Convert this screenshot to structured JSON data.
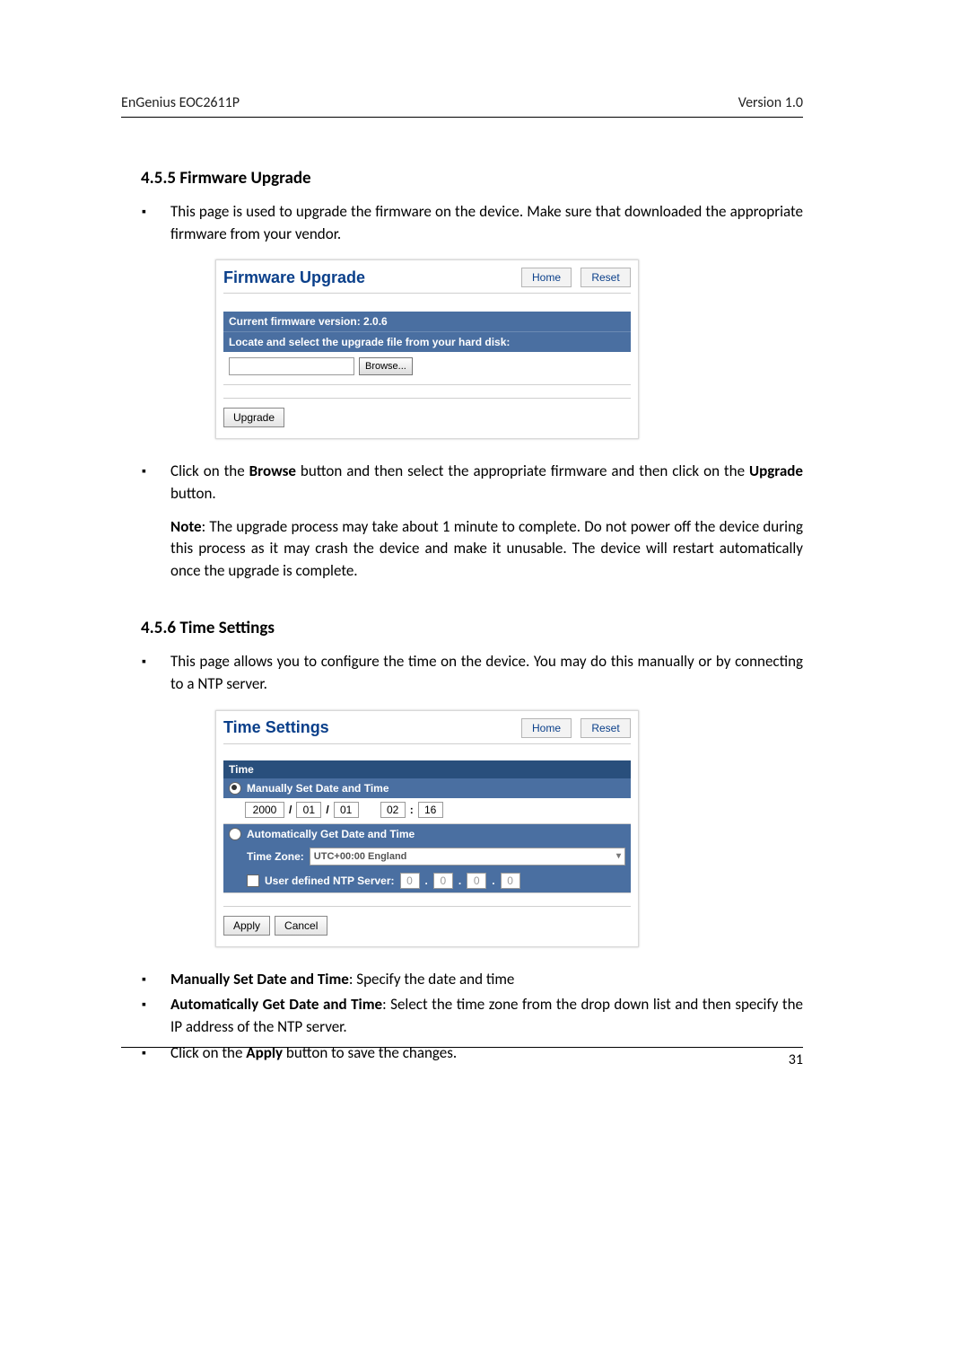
{
  "header": {
    "left": "EnGenius   EOC2611P",
    "right": "Version 1.0"
  },
  "page_num": "31",
  "s455": {
    "heading": "4.5.5   Firmware Upgrade",
    "intro": "This page is used to upgrade the firmware on the device. Make sure that downloaded the appropriate firmware from your vendor.",
    "shot": {
      "title": "Firmware Upgrade",
      "home": "Home",
      "reset": "Reset",
      "cur": "Current firmware version: 2.0.6",
      "locate": "Locate and select the upgrade file from your hard disk:",
      "browse": "Browse...",
      "upgrade": "Upgrade",
      "file_value": ""
    },
    "step_browse_pre": "Click on the ",
    "step_browse_b1": "Browse",
    "step_browse_mid": " button and then select the appropriate firmware and then click on the ",
    "step_browse_b2": "Upgrade",
    "step_browse_post": " button.",
    "note_b": "Note",
    "note": ": The upgrade process may take about 1 minute to complete. Do not power off the device during this process as it may crash the device and make it unusable. The device will restart automatically once the upgrade is complete."
  },
  "s456": {
    "heading": "4.5.6   Time Settings",
    "intro": "This page allows you to configure the time on the device. You may do this manually or by connecting to a NTP server.",
    "shot": {
      "title": "Time Settings",
      "home": "Home",
      "reset": "Reset",
      "bar_time": "Time",
      "manual": "Manually Set Date and Time",
      "year": "2000",
      "mon": "01",
      "day": "01",
      "hour": "02",
      "min": "16",
      "auto": "Automatically Get Date and Time",
      "tz_label": "Time Zone:",
      "tz_value": "UTC+00:00 England",
      "ntp_label": "User defined NTP Server:",
      "ip_a": "0",
      "ip_b": "0",
      "ip_c": "0",
      "ip_d": "0",
      "apply": "Apply",
      "cancel": "Cancel"
    },
    "b1_b": "Manually Set Date and Time",
    "b1": ": Specify the date and time",
    "b2_b": "Automatically Get Date and Time",
    "b2": ": Select the time zone from the drop down list and then specify the IP address of the NTP server.",
    "b3_pre": "Click on the ",
    "b3_b": "Apply",
    "b3_post": " button to save the changes."
  }
}
